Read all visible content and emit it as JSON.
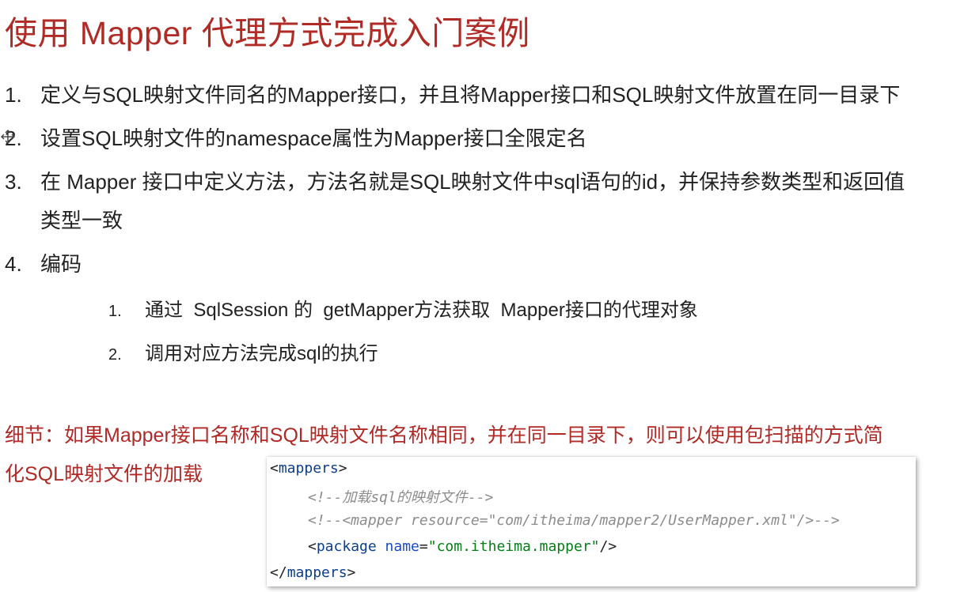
{
  "title": "使用 Mapper 代理方式完成入门案例",
  "steps": [
    {
      "num": "1.",
      "text": "定义与SQL映射文件同名的Mapper接口，并且将Mapper接口和SQL映射文件放置在同一目录下"
    },
    {
      "num": "2.",
      "text": "设置SQL映射文件的namespace属性为Mapper接口全限定名"
    },
    {
      "num": "3.",
      "text": "在 Mapper 接口中定义方法，方法名就是SQL映射文件中sql语句的id，并保持参数类型和返回值",
      "continuation": "类型一致"
    },
    {
      "num": "4.",
      "text": "编码"
    }
  ],
  "substeps": [
    {
      "num": "1.",
      "text": "通过  SqlSession 的  getMapper方法获取  Mapper接口的代理对象"
    },
    {
      "num": "2.",
      "text": "调用对应方法完成sql的执行"
    }
  ],
  "note": {
    "line1": "细节：如果Mapper接口名称和SQL映射文件名称相同，并在同一目录下，则可以使用包扫描的方式简",
    "line2": "化SQL映射文件的加载"
  },
  "code": {
    "open_tag": "mappers",
    "comment1": "<!--加载sql的映射文件-->",
    "comment2": "<!--<mapper resource=\"com/itheima/mapper2/UserMapper.xml\"/>-->",
    "package_tag": "package",
    "package_attr": "name",
    "package_value": "\"com.itheima.mapper\"",
    "close_tag": "mappers"
  },
  "colors": {
    "title": "#b02a26",
    "note": "#b02a26",
    "xml_tag": "#0b3f8c",
    "xml_string": "#067d17",
    "xml_comment": "#8c8c8c"
  },
  "icons": {
    "cursor": "move-cursor-icon"
  }
}
